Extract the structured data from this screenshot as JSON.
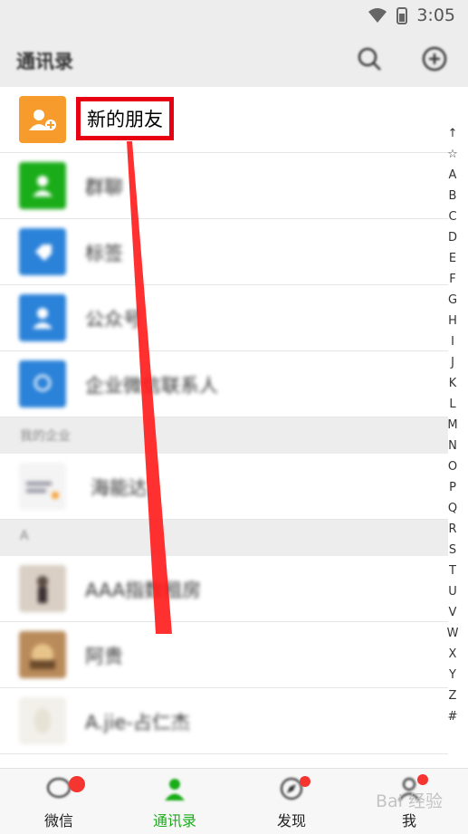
{
  "status": {
    "left": "",
    "time": "3:05"
  },
  "header": {
    "title": "通讯录"
  },
  "rows": [
    {
      "label": "新的朋友",
      "color": "#f79c2c"
    },
    {
      "label": "群聊",
      "color": "#1aad19"
    },
    {
      "label": "标签",
      "color": "#2b82d9"
    },
    {
      "label": "公众号",
      "color": "#2b82d9"
    },
    {
      "label": "企业微信联系人",
      "color": "#2b82d9"
    }
  ],
  "sections": {
    "enterprise": "我的企业",
    "a": "A"
  },
  "enterprise_row": {
    "label": "海能达"
  },
  "contacts": [
    {
      "label": "AAA指数租房"
    },
    {
      "label": "阿贵"
    },
    {
      "label": "A.jie-占仁杰"
    }
  ],
  "highlight": {
    "label": "新的朋友",
    "color": "#e60012"
  },
  "index": [
    "↑",
    "☆",
    "A",
    "B",
    "C",
    "D",
    "E",
    "F",
    "G",
    "H",
    "I",
    "J",
    "K",
    "L",
    "M",
    "N",
    "O",
    "P",
    "Q",
    "R",
    "S",
    "T",
    "U",
    "V",
    "W",
    "X",
    "Y",
    "Z",
    "#"
  ],
  "tabs": [
    {
      "label": "微信",
      "active": false
    },
    {
      "label": "通讯录",
      "active": true
    },
    {
      "label": "发现",
      "active": false
    },
    {
      "label": "我",
      "active": false
    }
  ],
  "accent": "#1aad19",
  "watermark": "Bai 经验"
}
